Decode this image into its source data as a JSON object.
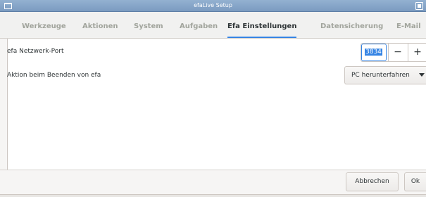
{
  "window": {
    "title": "efaLive Setup"
  },
  "tabs": [
    {
      "label": "Werkzeuge",
      "active": false
    },
    {
      "label": "Aktionen",
      "active": false
    },
    {
      "label": "System",
      "active": false
    },
    {
      "label": "Aufgaben",
      "active": false
    },
    {
      "label": "Efa Einstellungen",
      "active": true
    },
    {
      "label": "Datensicherung",
      "active": false
    },
    {
      "label": "E-Mail",
      "active": false
    }
  ],
  "settings": {
    "port_label": "efa Netzwerk-Port",
    "port_value": "3834",
    "minus_symbol": "−",
    "plus_symbol": "+",
    "exit_action_label": "Aktion beim Beenden von efa",
    "exit_action_value": "PC herunterfahren"
  },
  "footer": {
    "cancel_label": "Abbrechen",
    "ok_label": "Ok"
  },
  "colors": {
    "accent": "#3584e4",
    "titlebar": "#7b9bc0",
    "active_tab": "#2e3436",
    "inactive_tab": "#a1a49c"
  }
}
